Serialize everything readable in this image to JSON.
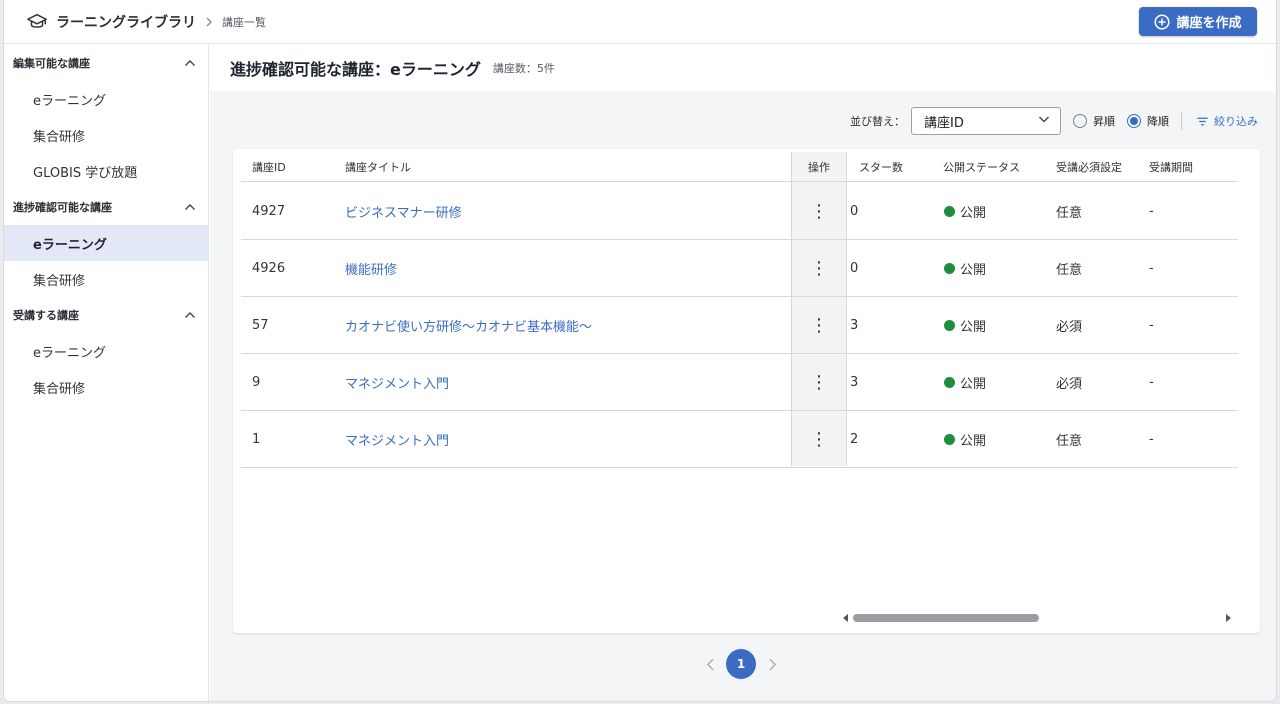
{
  "header": {
    "app_title": "ラーニングライブラリ",
    "breadcrumb_current": "講座一覧",
    "create_button": "講座を作成"
  },
  "sidebar": {
    "sections": [
      {
        "title": "編集可能な講座",
        "items": [
          "eラーニング",
          "集合研修",
          "GLOBIS 学び放題"
        ]
      },
      {
        "title": "進捗確認可能な講座",
        "items": [
          "eラーニング",
          "集合研修"
        ]
      },
      {
        "title": "受講する講座",
        "items": [
          "eラーニング",
          "集合研修"
        ]
      }
    ],
    "active": "進捗確認可能な講座 / eラーニング"
  },
  "main": {
    "title": "進捗確認可能な講座：eラーニング",
    "count": "講座数：5件",
    "sort_label": "並び替え：",
    "sort_value": "講座ID",
    "order_asc": "昇順",
    "order_desc": "降順",
    "order_selected": "降順",
    "filter": "絞り込み"
  },
  "table": {
    "columns": [
      "講座ID",
      "講座タイトル",
      "操作",
      "スター数",
      "公開ステータス",
      "受講必須設定",
      "受講期間"
    ],
    "rows": [
      {
        "id": "4927",
        "title": "ビジネスマナー研修",
        "op": "⋮",
        "stars": "0",
        "status": "公開",
        "required": "任意",
        "period": "-"
      },
      {
        "id": "4926",
        "title": "機能研修",
        "op": "⋮",
        "stars": "0",
        "status": "公開",
        "required": "任意",
        "period": "-"
      },
      {
        "id": "57",
        "title": "カオナビ使い方研修～カオナビ基本機能～",
        "op": "⋮",
        "stars": "3",
        "status": "公開",
        "required": "必須",
        "period": "-"
      },
      {
        "id": "9",
        "title": "マネジメント入門",
        "op": "⋮",
        "stars": "3",
        "status": "公開",
        "required": "必須",
        "period": "-"
      },
      {
        "id": "1",
        "title": "マネジメント入門",
        "op": "⋮",
        "stars": "2",
        "status": "公開",
        "required": "任意",
        "period": "-"
      }
    ]
  },
  "pagination": {
    "current": "1"
  },
  "colors": {
    "accent": "#3b6cc4",
    "published": "#1e8e3e",
    "active_bg": "#e3e8f6"
  }
}
